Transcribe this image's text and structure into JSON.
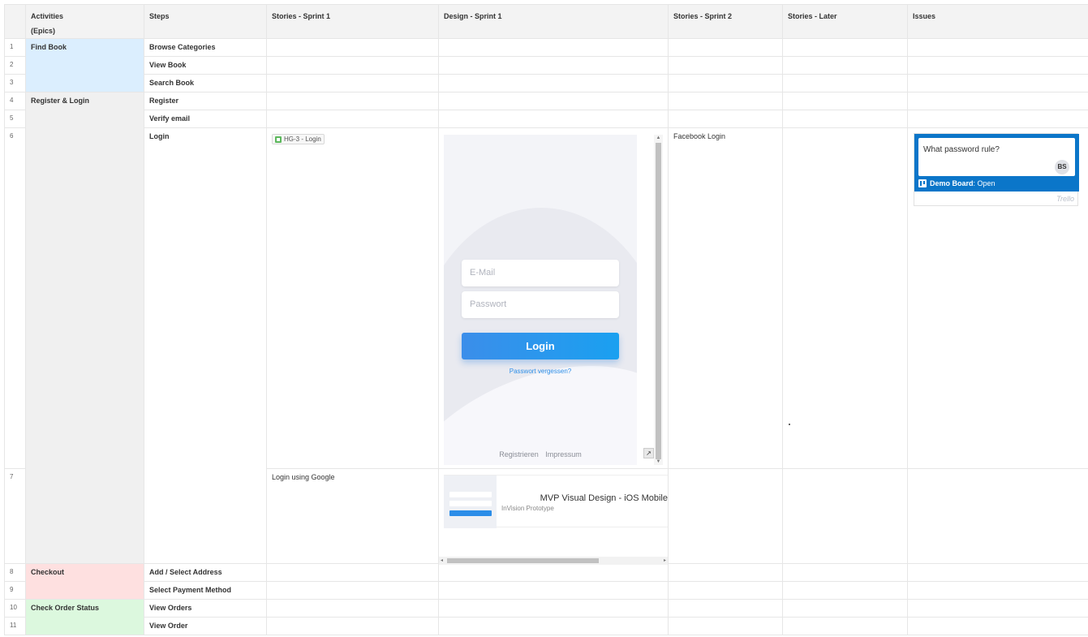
{
  "headers": {
    "col_activities": "Activities",
    "col_activities_sub": "(Epics)",
    "col_steps": "Steps",
    "col_sprint1": "Stories - Sprint 1",
    "col_design1": "Design - Sprint 1",
    "col_sprint2": "Stories - Sprint 2",
    "col_later": "Stories - Later",
    "col_issues": "Issues"
  },
  "rows": [
    {
      "num": "1",
      "epic": "Find Book",
      "step": "Browse Categories"
    },
    {
      "num": "2",
      "epic": "",
      "step": "View Book"
    },
    {
      "num": "3",
      "epic": "",
      "step": "Search Book"
    },
    {
      "num": "4",
      "epic": "Register & Login",
      "step": "Register"
    },
    {
      "num": "5",
      "epic": "",
      "step": "Verify email"
    },
    {
      "num": "6",
      "epic": "",
      "step": "Login",
      "sprint1_chip": "HG-3 - Login",
      "sprint2": "Facebook Login"
    },
    {
      "num": "7",
      "epic": "",
      "step": "",
      "sprint1": "Login using Google"
    },
    {
      "num": "8",
      "epic": "Checkout",
      "step": "Add / Select Address"
    },
    {
      "num": "9",
      "epic": "",
      "step": "Select Payment Method"
    },
    {
      "num": "10",
      "epic": "Check Order Status",
      "step": "View Orders"
    },
    {
      "num": "11",
      "epic": "",
      "step": "View Order"
    }
  ],
  "mockup": {
    "email_placeholder": "E-Mail",
    "password_placeholder": "Passwort",
    "login_button": "Login",
    "forgot": "Passwort vergessen?",
    "footer": "Registrieren Impressum"
  },
  "preview": {
    "title": "MVP Visual Design - iOS Mobile",
    "subtitle": "InVision Prototype"
  },
  "trello": {
    "question": "What password rule?",
    "avatar": "BS",
    "board_name": "Demo Board",
    "board_status": ": Open",
    "logo": "Trello"
  },
  "colors": {
    "find_book": "#dbeefe",
    "register_login": "#f0f0f0",
    "checkout": "#fee0e0",
    "check_order": "#dcf8de",
    "trello_blue": "#0b76c9"
  },
  "icons": [
    "jira-issue-icon",
    "expand-icon",
    "trello-board-icon",
    "trello-logo-icon"
  ]
}
